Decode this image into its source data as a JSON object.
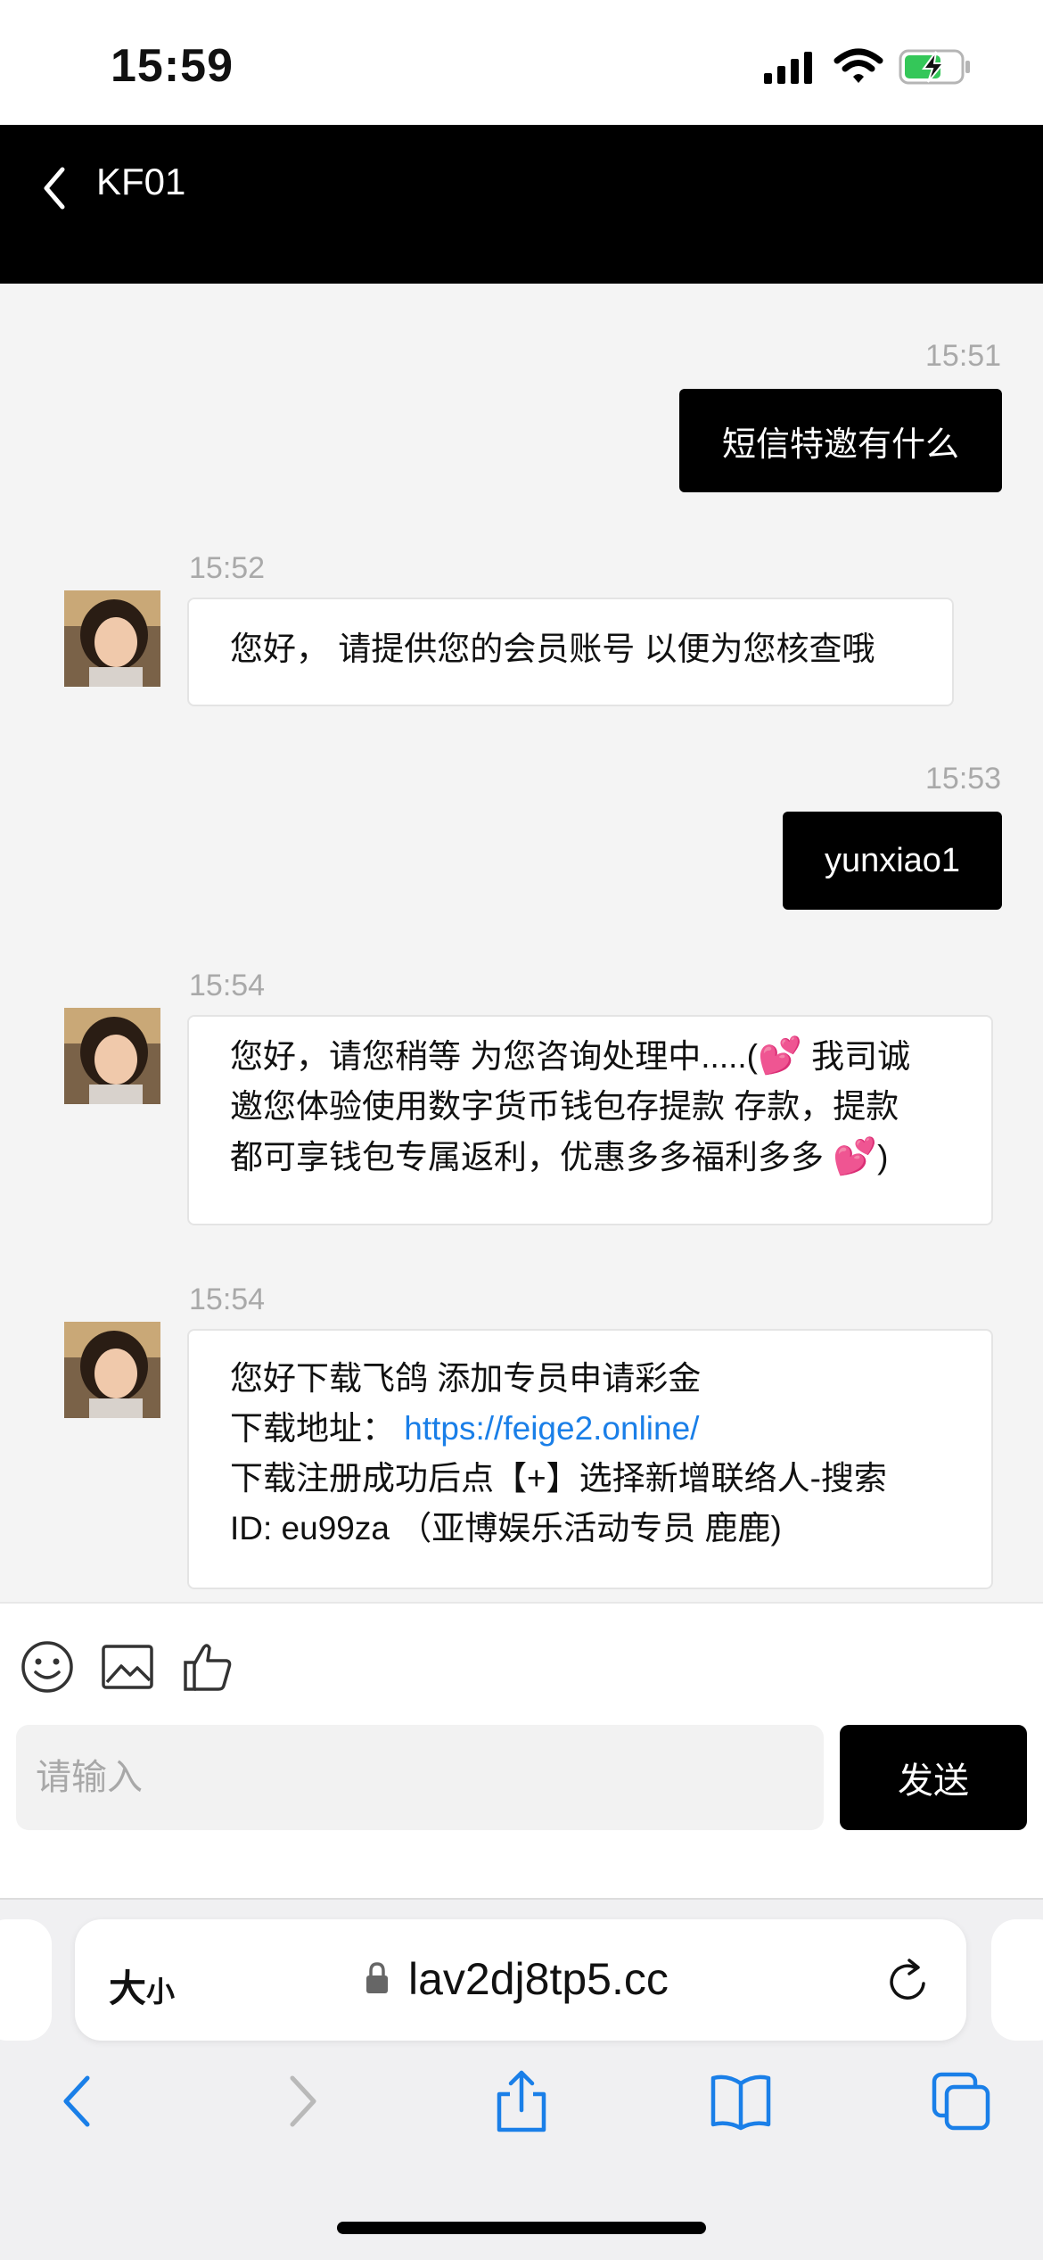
{
  "status_bar": {
    "time": "15:59"
  },
  "header": {
    "title": "KF01"
  },
  "messages": [
    {
      "side": "out",
      "time": "15:51",
      "text": "短信特邀有什么"
    },
    {
      "side": "in",
      "time": "15:52",
      "lines": [
        "您好， 请提供您的会员账号 以便为您核查哦"
      ]
    },
    {
      "side": "out",
      "time": "15:53",
      "text": "yunxiao1"
    },
    {
      "side": "in",
      "time": "15:54",
      "lines": [
        {
          "a": "您好，请您稍等 为您咨询处理中.....(",
          "emoji": "💕",
          "b": "我司诚"
        },
        "邀您体验使用数字货币钱包存提款 存款，提款",
        {
          "a": "都可享钱包专属返利，优惠多多福利多多 ",
          "emoji": "💕",
          "b": ")"
        }
      ]
    },
    {
      "side": "in",
      "time": "15:54",
      "lines": [
        "您好下载飞鸽 添加专员申请彩金",
        {
          "label": "下载地址：",
          "link": "https://feige2.online/"
        },
        "下载注册成功后点【+】选择新增联络人-搜索",
        "ID: eu99za （亚博娱乐活动专员 鹿鹿)"
      ]
    }
  ],
  "input": {
    "placeholder": "请输入",
    "send_label": "发送"
  },
  "browser": {
    "text_size_big": "大",
    "text_size_small": "小",
    "url": "lav2dj8tp5.cc"
  },
  "colors": {
    "header_bg": "#000000",
    "chat_bg": "#f4f4f4",
    "link": "#1a7fe8",
    "battery_fill": "#34c759"
  }
}
